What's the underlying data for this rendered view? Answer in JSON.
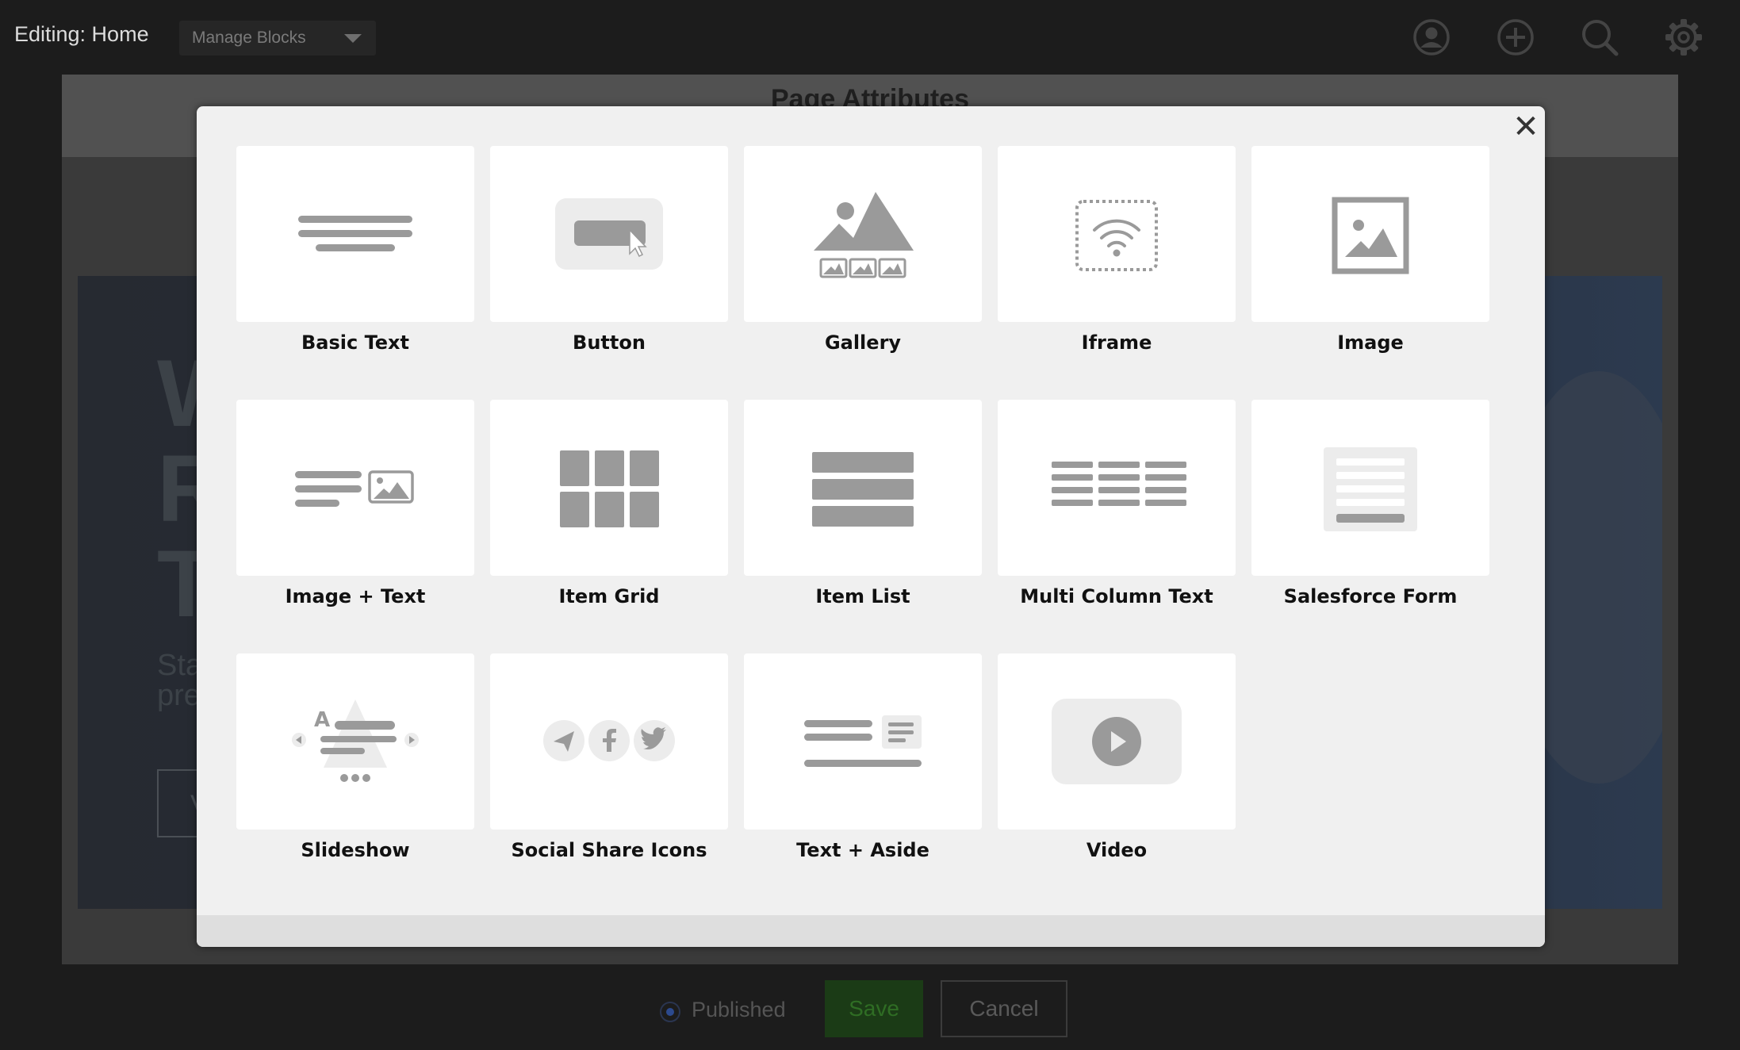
{
  "topbar": {
    "editing_label": "Editing: Home",
    "manage_blocks_label": "Manage Blocks",
    "icons": [
      "user-icon",
      "add-icon",
      "search-icon",
      "gear-icon"
    ]
  },
  "page": {
    "header_title": "Page Attributes",
    "hero_lines": [
      "W",
      "R",
      "T"
    ],
    "hero_sub_lines": [
      "Star",
      "prep"
    ],
    "hero_button": "Vi"
  },
  "bottom": {
    "published_label": "Published",
    "save_label": "Save",
    "cancel_label": "Cancel"
  },
  "modal": {
    "close_label": "✕",
    "blocks": [
      {
        "label": "Basic Text",
        "icon": "basic-text-icon"
      },
      {
        "label": "Button",
        "icon": "button-icon"
      },
      {
        "label": "Gallery",
        "icon": "gallery-icon"
      },
      {
        "label": "Iframe",
        "icon": "iframe-icon"
      },
      {
        "label": "Image",
        "icon": "image-icon"
      },
      {
        "label": "Image + Text",
        "icon": "image-text-icon"
      },
      {
        "label": "Item Grid",
        "icon": "item-grid-icon"
      },
      {
        "label": "Item List",
        "icon": "item-list-icon"
      },
      {
        "label": "Multi Column Text",
        "icon": "multi-column-text-icon"
      },
      {
        "label": "Salesforce Form",
        "icon": "salesforce-form-icon"
      },
      {
        "label": "Slideshow",
        "icon": "slideshow-icon"
      },
      {
        "label": "Social Share Icons",
        "icon": "social-share-icon"
      },
      {
        "label": "Text + Aside",
        "icon": "text-aside-icon"
      },
      {
        "label": "Video",
        "icon": "video-icon"
      }
    ]
  },
  "colors": {
    "icon_gray": "#9a9a9a",
    "modal_bg": "#f0f0f0",
    "card_bg": "#ffffff",
    "save_green": "#1b3b16"
  }
}
